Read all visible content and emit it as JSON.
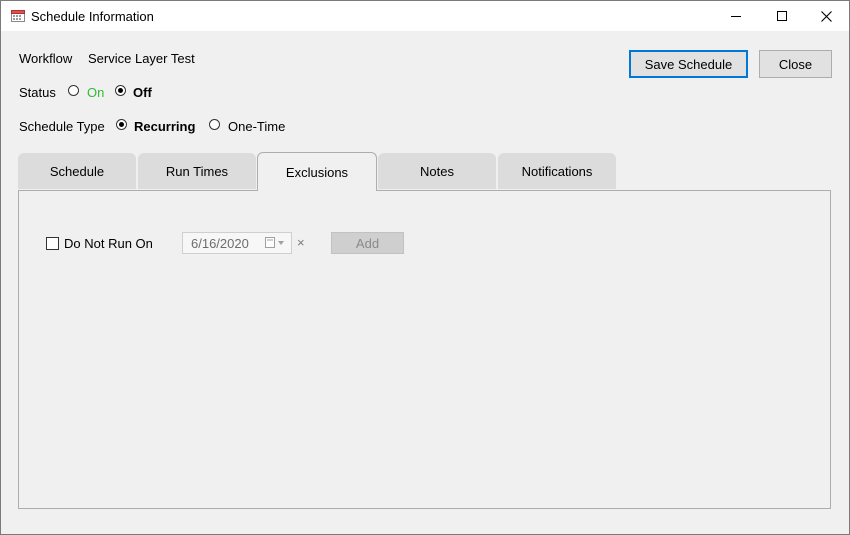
{
  "window": {
    "title": "Schedule Information"
  },
  "workflow": {
    "label": "Workflow",
    "value": "Service Layer Test"
  },
  "status": {
    "label": "Status",
    "options": [
      {
        "label": "On",
        "checked": false,
        "color": "#33bb33"
      },
      {
        "label": "Off",
        "checked": true
      }
    ]
  },
  "schedule_type": {
    "label": "Schedule Type",
    "options": [
      {
        "label": "Recurring",
        "checked": true
      },
      {
        "label": "One-Time",
        "checked": false
      }
    ]
  },
  "buttons": {
    "save": "Save Schedule",
    "close": "Close"
  },
  "tabs": [
    {
      "label": "Schedule",
      "active": false
    },
    {
      "label": "Run Times",
      "active": false
    },
    {
      "label": "Exclusions",
      "active": true
    },
    {
      "label": "Notes",
      "active": false
    },
    {
      "label": "Notifications",
      "active": false
    }
  ],
  "exclusions": {
    "checkbox_label": "Do Not Run On",
    "checked": false,
    "date_value": "6/16/2020",
    "clear_glyph": "×",
    "add_label": "Add"
  },
  "icons": {
    "app": "calendar-icon",
    "minimize": "minimize-icon",
    "maximize": "maximize-icon",
    "close": "close-icon",
    "date_picker": "calendar-dropdown-icon"
  }
}
